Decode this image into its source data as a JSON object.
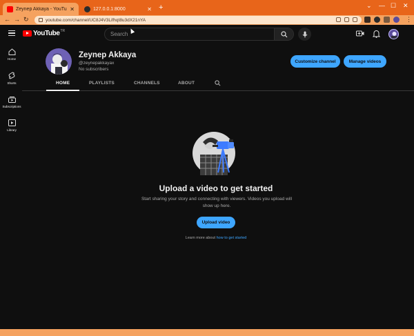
{
  "browser": {
    "tabs": [
      {
        "title": "Zeynep Akkaya - YouTube",
        "active": true
      },
      {
        "title": "127.0.0.1:8000",
        "active": false
      }
    ],
    "url": "youtube.com/channel/UC8J4V3Lifhqt8u3dX21nYA"
  },
  "header": {
    "search_placeholder": "Search"
  },
  "rail": {
    "items": [
      {
        "label": "Home",
        "icon": "home-icon"
      },
      {
        "label": "Shorts",
        "icon": "shorts-icon"
      },
      {
        "label": "Subscriptions",
        "icon": "subscriptions-icon"
      },
      {
        "label": "Library",
        "icon": "library-icon"
      }
    ]
  },
  "channel": {
    "name": "Zeynep Akkaya",
    "handle": "@zeynepakkayax",
    "subscribers": "No subscribers",
    "customize_label": "Customize channel",
    "manage_label": "Manage videos",
    "tabs": [
      "HOME",
      "PLAYLISTS",
      "CHANNELS",
      "ABOUT"
    ]
  },
  "empty_state": {
    "title": "Upload a video to get started",
    "description": "Start sharing your story and connecting with viewers. Videos you upload will show up here.",
    "upload_label": "Upload video",
    "learn_prefix": "Learn more about",
    "learn_link": "how to get started"
  },
  "colors": {
    "browser_frame": "#e8651a",
    "accent": "#3ea6ff",
    "background": "#0f0f0f",
    "youtube_red": "#ff0000"
  }
}
